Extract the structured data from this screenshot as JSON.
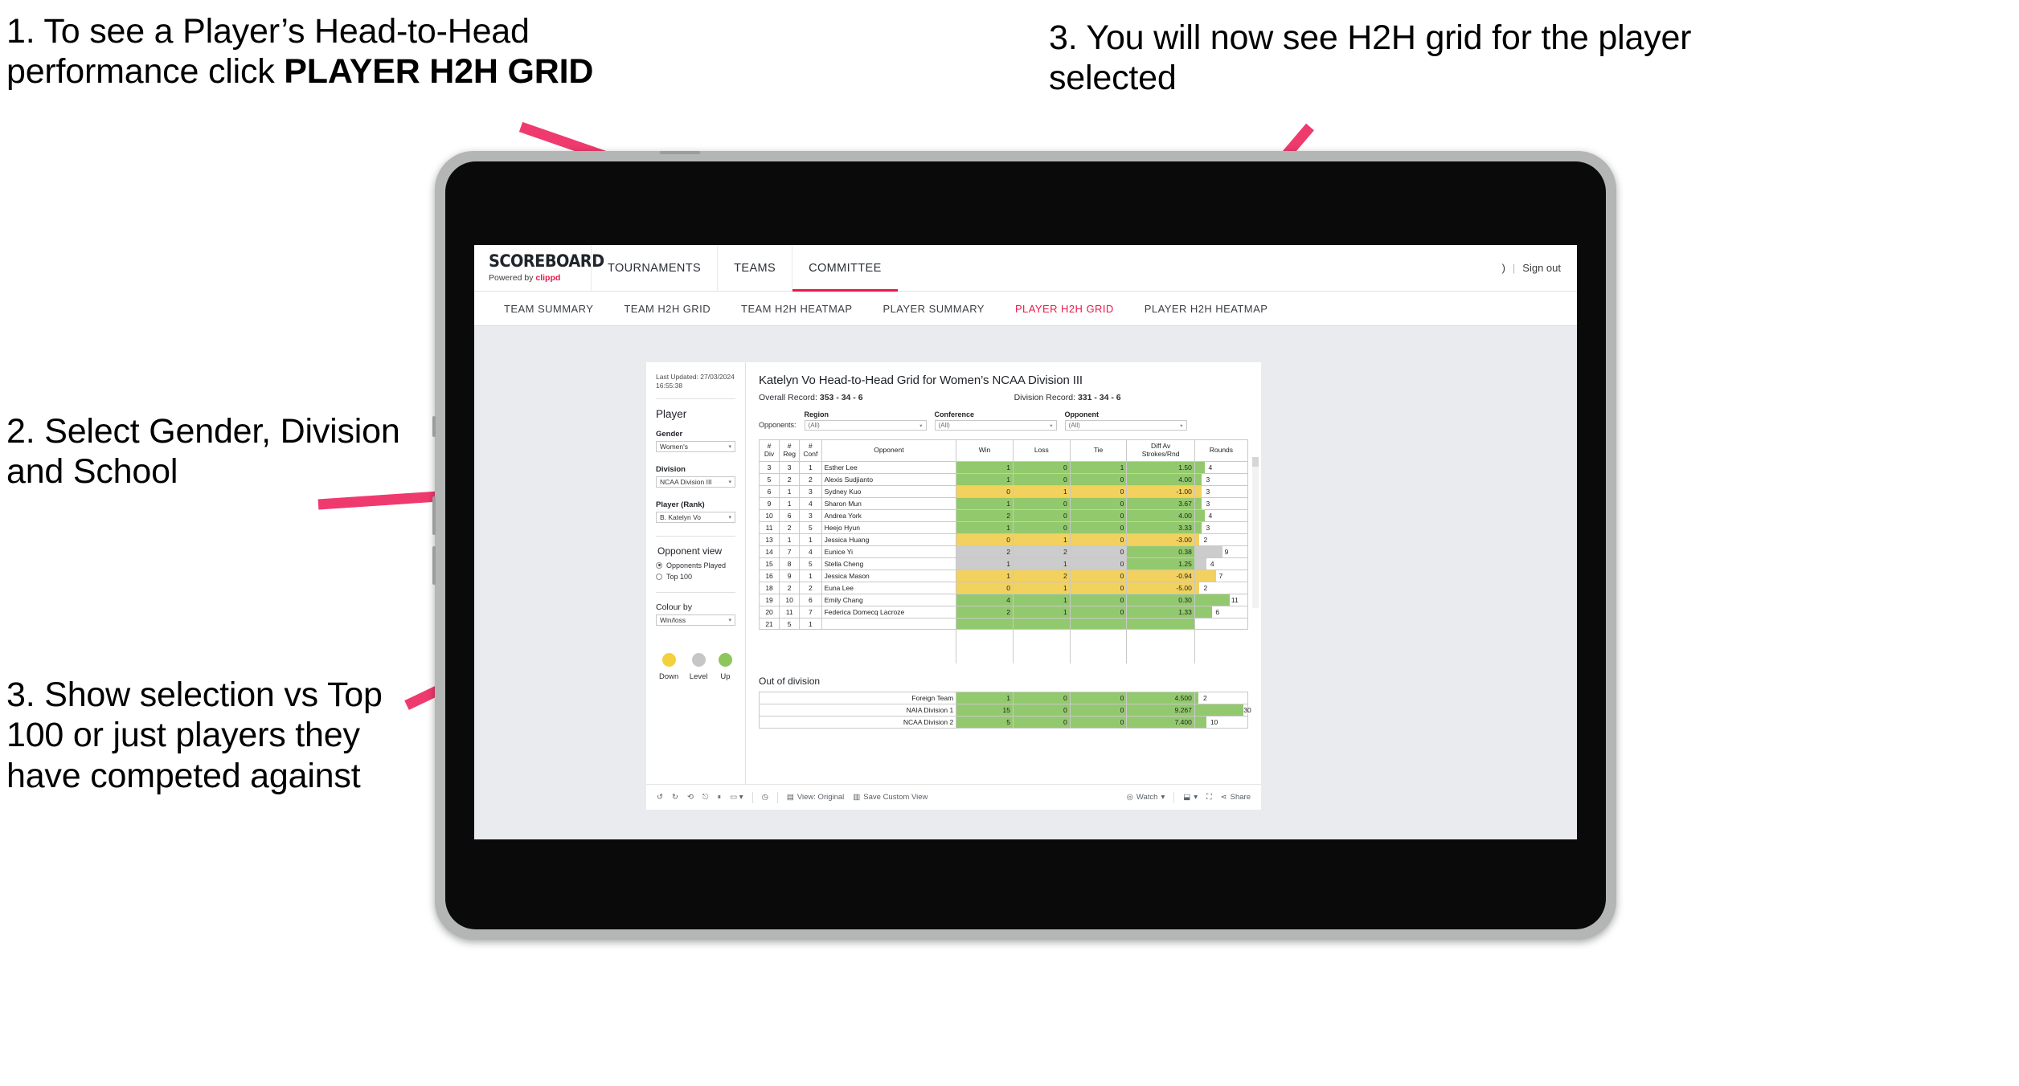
{
  "annotations": [
    {
      "id": "anno1",
      "text_before": "1. To see a Player’s Head-to-Head performance click ",
      "text_bold": "PLAYER H2H GRID"
    },
    {
      "id": "anno2",
      "text": "2. Select Gender, Division and School"
    },
    {
      "id": "anno3",
      "text": "3. Show selection vs Top 100 or just players they have competed against"
    },
    {
      "id": "anno4",
      "text": "3. You will now see H2H grid for the player selected"
    }
  ],
  "colors": {
    "accent": "#e8194b",
    "up": "#8dc65c",
    "down": "#f2d13c",
    "level": "#c6c6c6",
    "bar_green": "#93c96e",
    "bar_yellow": "#f2d15e",
    "bar_grey": "#cccccc"
  },
  "brand": {
    "name": "SCOREBOARD",
    "tagline_prefix": "Powered by ",
    "tagline_brand": "clippd"
  },
  "topnav": {
    "tabs": [
      {
        "label": "TOURNAMENTS",
        "active": false
      },
      {
        "label": "TEAMS",
        "active": false
      },
      {
        "label": "COMMITTEE",
        "active": true
      }
    ],
    "user_truncated": ")",
    "separator": "|",
    "signout": "Sign out"
  },
  "subnav": {
    "tabs": [
      {
        "label": "TEAM SUMMARY",
        "active": false
      },
      {
        "label": "TEAM H2H GRID",
        "active": false
      },
      {
        "label": "TEAM H2H HEATMAP",
        "active": false
      },
      {
        "label": "PLAYER SUMMARY",
        "active": false
      },
      {
        "label": "PLAYER H2H GRID",
        "active": true
      },
      {
        "label": "PLAYER H2H HEATMAP",
        "active": false
      }
    ]
  },
  "panel": {
    "last_updated": "Last Updated: 27/03/2024 16:55:38",
    "heading": "Player",
    "filters": [
      {
        "label": "Gender",
        "value": "Women's"
      },
      {
        "label": "Division",
        "value": "NCAA Division III"
      },
      {
        "label": "Player (Rank)",
        "value": "B. Katelyn Vo"
      }
    ],
    "opponent_view": {
      "heading": "Opponent view",
      "options": [
        {
          "label": "Opponents Played",
          "selected": true
        },
        {
          "label": "Top 100",
          "selected": false
        }
      ]
    },
    "colour_by": {
      "label": "Colour by",
      "value": "Win/loss"
    },
    "legend": [
      {
        "label": "Down",
        "color": "#f2d13c"
      },
      {
        "label": "Level",
        "color": "#c6c6c6"
      },
      {
        "label": "Up",
        "color": "#8dc65c"
      }
    ]
  },
  "content": {
    "title": "Katelyn Vo Head-to-Head Grid for Women’s NCAA Division III",
    "overall_label": "Overall Record: ",
    "overall_value": "353 - 34 - 6",
    "division_label": "Division Record: ",
    "division_value": "331 - 34 - 6",
    "opponents_label": "Opponents:",
    "filters": [
      {
        "label": "Region",
        "value": "(All)"
      },
      {
        "label": "Conference",
        "value": "(All)"
      },
      {
        "label": "Opponent",
        "value": "(All)"
      }
    ],
    "table": {
      "headers": [
        "#\nDiv",
        "#\nReg",
        "#\nConf",
        "Opponent",
        "Win",
        "Loss",
        "Tie",
        "Diff Av\nStrokes/Rnd",
        "Rounds"
      ],
      "rows": [
        {
          "div": "3",
          "reg": "3",
          "conf": "1",
          "opponent": "Esther Lee",
          "win": "1",
          "loss": "0",
          "tie": "1",
          "diff": "1.50",
          "rounds": "4",
          "color": "green",
          "bar_pct": 18
        },
        {
          "div": "5",
          "reg": "2",
          "conf": "2",
          "opponent": "Alexis Sudjianto",
          "win": "1",
          "loss": "0",
          "tie": "0",
          "diff": "4.00",
          "rounds": "3",
          "color": "green",
          "bar_pct": 13
        },
        {
          "div": "6",
          "reg": "1",
          "conf": "3",
          "opponent": "Sydney Kuo",
          "win": "0",
          "loss": "1",
          "tie": "0",
          "diff": "-1.00",
          "rounds": "3",
          "color": "yellow",
          "bar_pct": 13
        },
        {
          "div": "9",
          "reg": "1",
          "conf": "4",
          "opponent": "Sharon Mun",
          "win": "1",
          "loss": "0",
          "tie": "0",
          "diff": "3.67",
          "rounds": "3",
          "color": "green",
          "bar_pct": 13
        },
        {
          "div": "10",
          "reg": "6",
          "conf": "3",
          "opponent": "Andrea York",
          "win": "2",
          "loss": "0",
          "tie": "0",
          "diff": "4.00",
          "rounds": "4",
          "color": "green",
          "bar_pct": 18
        },
        {
          "div": "11",
          "reg": "2",
          "conf": "5",
          "opponent": "Heejo Hyun",
          "win": "1",
          "loss": "0",
          "tie": "0",
          "diff": "3.33",
          "rounds": "3",
          "color": "green",
          "bar_pct": 13
        },
        {
          "div": "13",
          "reg": "1",
          "conf": "1",
          "opponent": "Jessica Huang",
          "win": "0",
          "loss": "1",
          "tie": "0",
          "diff": "-3.00",
          "rounds": "2",
          "color": "yellow",
          "bar_pct": 8
        },
        {
          "div": "14",
          "reg": "7",
          "conf": "4",
          "opponent": "Eunice Yi",
          "win": "2",
          "loss": "2",
          "tie": "0",
          "diff": "0.38",
          "rounds": "9",
          "color": "grey",
          "diff_color": "green",
          "bar_pct": 52
        },
        {
          "div": "15",
          "reg": "8",
          "conf": "5",
          "opponent": "Stella Cheng",
          "win": "1",
          "loss": "1",
          "tie": "0",
          "diff": "1.25",
          "rounds": "4",
          "color": "grey",
          "diff_color": "green",
          "bar_pct": 22
        },
        {
          "div": "16",
          "reg": "9",
          "conf": "1",
          "opponent": "Jessica Mason",
          "win": "1",
          "loss": "2",
          "tie": "0",
          "diff": "-0.94",
          "rounds": "7",
          "color": "yellow",
          "bar_pct": 40
        },
        {
          "div": "18",
          "reg": "2",
          "conf": "2",
          "opponent": "Euna Lee",
          "win": "0",
          "loss": "1",
          "tie": "0",
          "diff": "-5.00",
          "rounds": "2",
          "color": "yellow",
          "bar_pct": 8
        },
        {
          "div": "19",
          "reg": "10",
          "conf": "6",
          "opponent": "Emily Chang",
          "win": "4",
          "loss": "1",
          "tie": "0",
          "diff": "0.30",
          "rounds": "11",
          "color": "green",
          "bar_pct": 66
        },
        {
          "div": "20",
          "reg": "11",
          "conf": "7",
          "opponent": "Federica Domecq Lacroze",
          "win": "2",
          "loss": "1",
          "tie": "0",
          "diff": "1.33",
          "rounds": "6",
          "color": "green",
          "bar_pct": 33
        }
      ]
    },
    "out_of_division": {
      "heading": "Out of division",
      "rows": [
        {
          "label": "Foreign Team",
          "win": "1",
          "loss": "0",
          "tie": "0",
          "diff": "4.500",
          "rounds": "2",
          "color": "green",
          "bar_pct": 7
        },
        {
          "label": "NAIA Division 1",
          "win": "15",
          "loss": "0",
          "tie": "0",
          "diff": "9.267",
          "rounds": "30",
          "color": "green",
          "bar_pct": 92
        },
        {
          "label": "NCAA Division 2",
          "win": "5",
          "loss": "0",
          "tie": "0",
          "diff": "7.400",
          "rounds": "10",
          "color": "green",
          "bar_pct": 22
        }
      ]
    }
  },
  "toolbar": {
    "view_label": "View: Original",
    "save_label": "Save Custom View",
    "watch_label": "Watch",
    "share_label": "Share"
  }
}
